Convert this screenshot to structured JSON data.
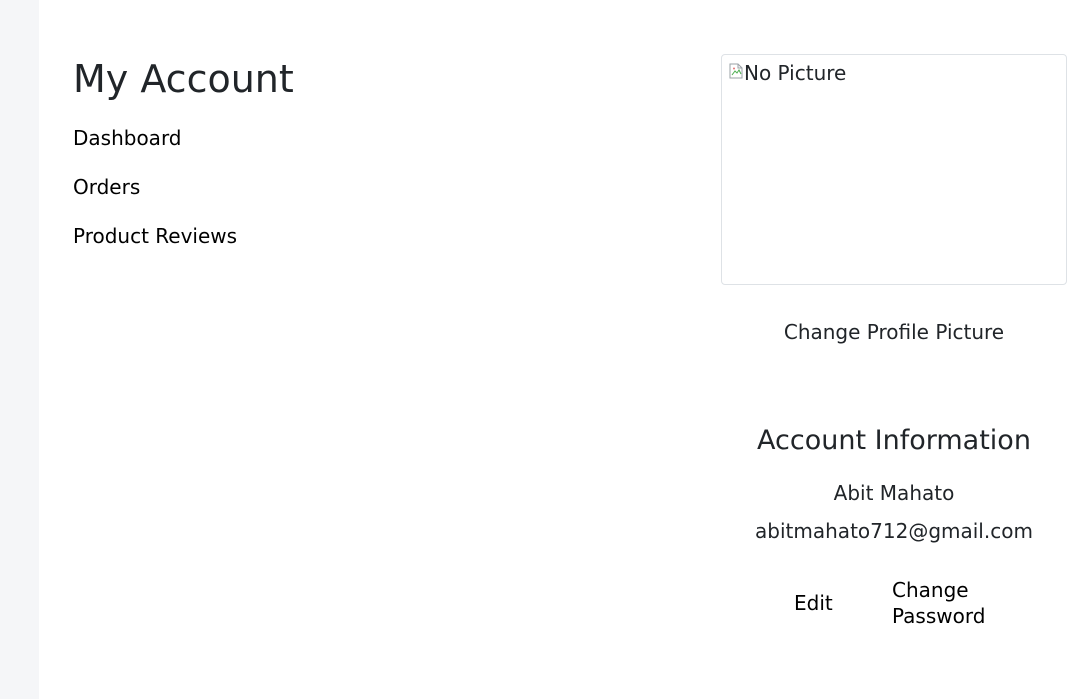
{
  "sidebar": {
    "title": "My Account",
    "items": [
      {
        "label": "Dashboard"
      },
      {
        "label": "Orders"
      },
      {
        "label": "Product Reviews"
      }
    ]
  },
  "profile": {
    "picture_alt": "No Picture",
    "change_picture_label": "Change Profile Picture"
  },
  "account": {
    "heading": "Account Information",
    "name": "Abit Mahato",
    "email": "abitmahato712@gmail.com",
    "edit_label": "Edit",
    "change_password_label": "Change Password"
  }
}
